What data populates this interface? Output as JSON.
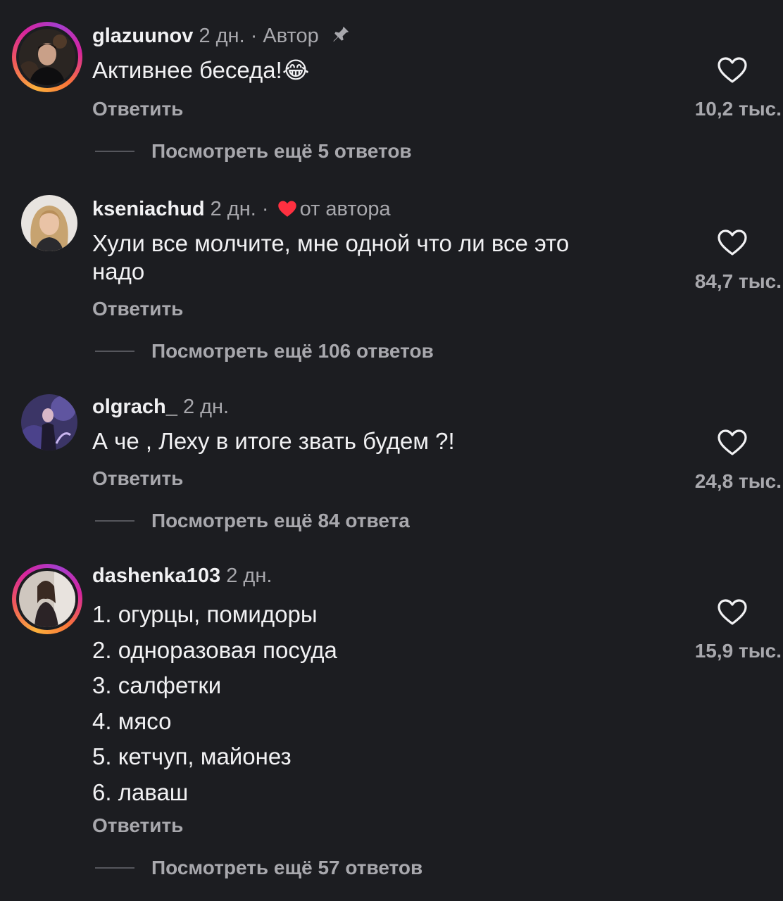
{
  "comments": [
    {
      "username": "glazuunov",
      "time": "2 дн.",
      "separator": " · ",
      "tag": "Автор",
      "text_lines": [
        "Активнее беседа!😂"
      ],
      "reply_label": "Ответить",
      "more_replies": "Посмотреть ещё 5 ответов",
      "likes": "10,2 тыс."
    },
    {
      "username": "kseniachud",
      "time": "2 дн.",
      "separator": " · ",
      "tag": "от автора",
      "text_lines": [
        "Хули все молчите, мне одной что ли все это",
        "надо"
      ],
      "reply_label": "Ответить",
      "more_replies": "Посмотреть ещё 106 ответов",
      "likes": "84,7 тыс."
    },
    {
      "username": "olgrach_",
      "time": "2 дн.",
      "text_lines": [
        "А че , Леху в итоге звать будем ?!"
      ],
      "reply_label": "Ответить",
      "more_replies": "Посмотреть ещё 84 ответа",
      "likes": "24,8 тыс."
    },
    {
      "username": "dashenka103",
      "time": "2 дн.",
      "text_lines": [
        "1. огурцы, помидоры",
        "2. одноразовая посуда",
        "3. салфетки",
        "4. мясо",
        "5. кетчуп, майонез",
        "6. лаваш"
      ],
      "reply_label": "Ответить",
      "more_replies": "Посмотреть ещё 57 ответов",
      "likes": "15,9 тыс."
    }
  ],
  "icons": {
    "like": "heart-outline-icon",
    "liked_by_author": "heart-filled-icon",
    "pinned": "pin-icon"
  },
  "colors": {
    "background": "#1c1d21",
    "primary_text": "#f1f1f3",
    "secondary_text": "#a8a8ad",
    "author_heart": "#ff3040"
  }
}
